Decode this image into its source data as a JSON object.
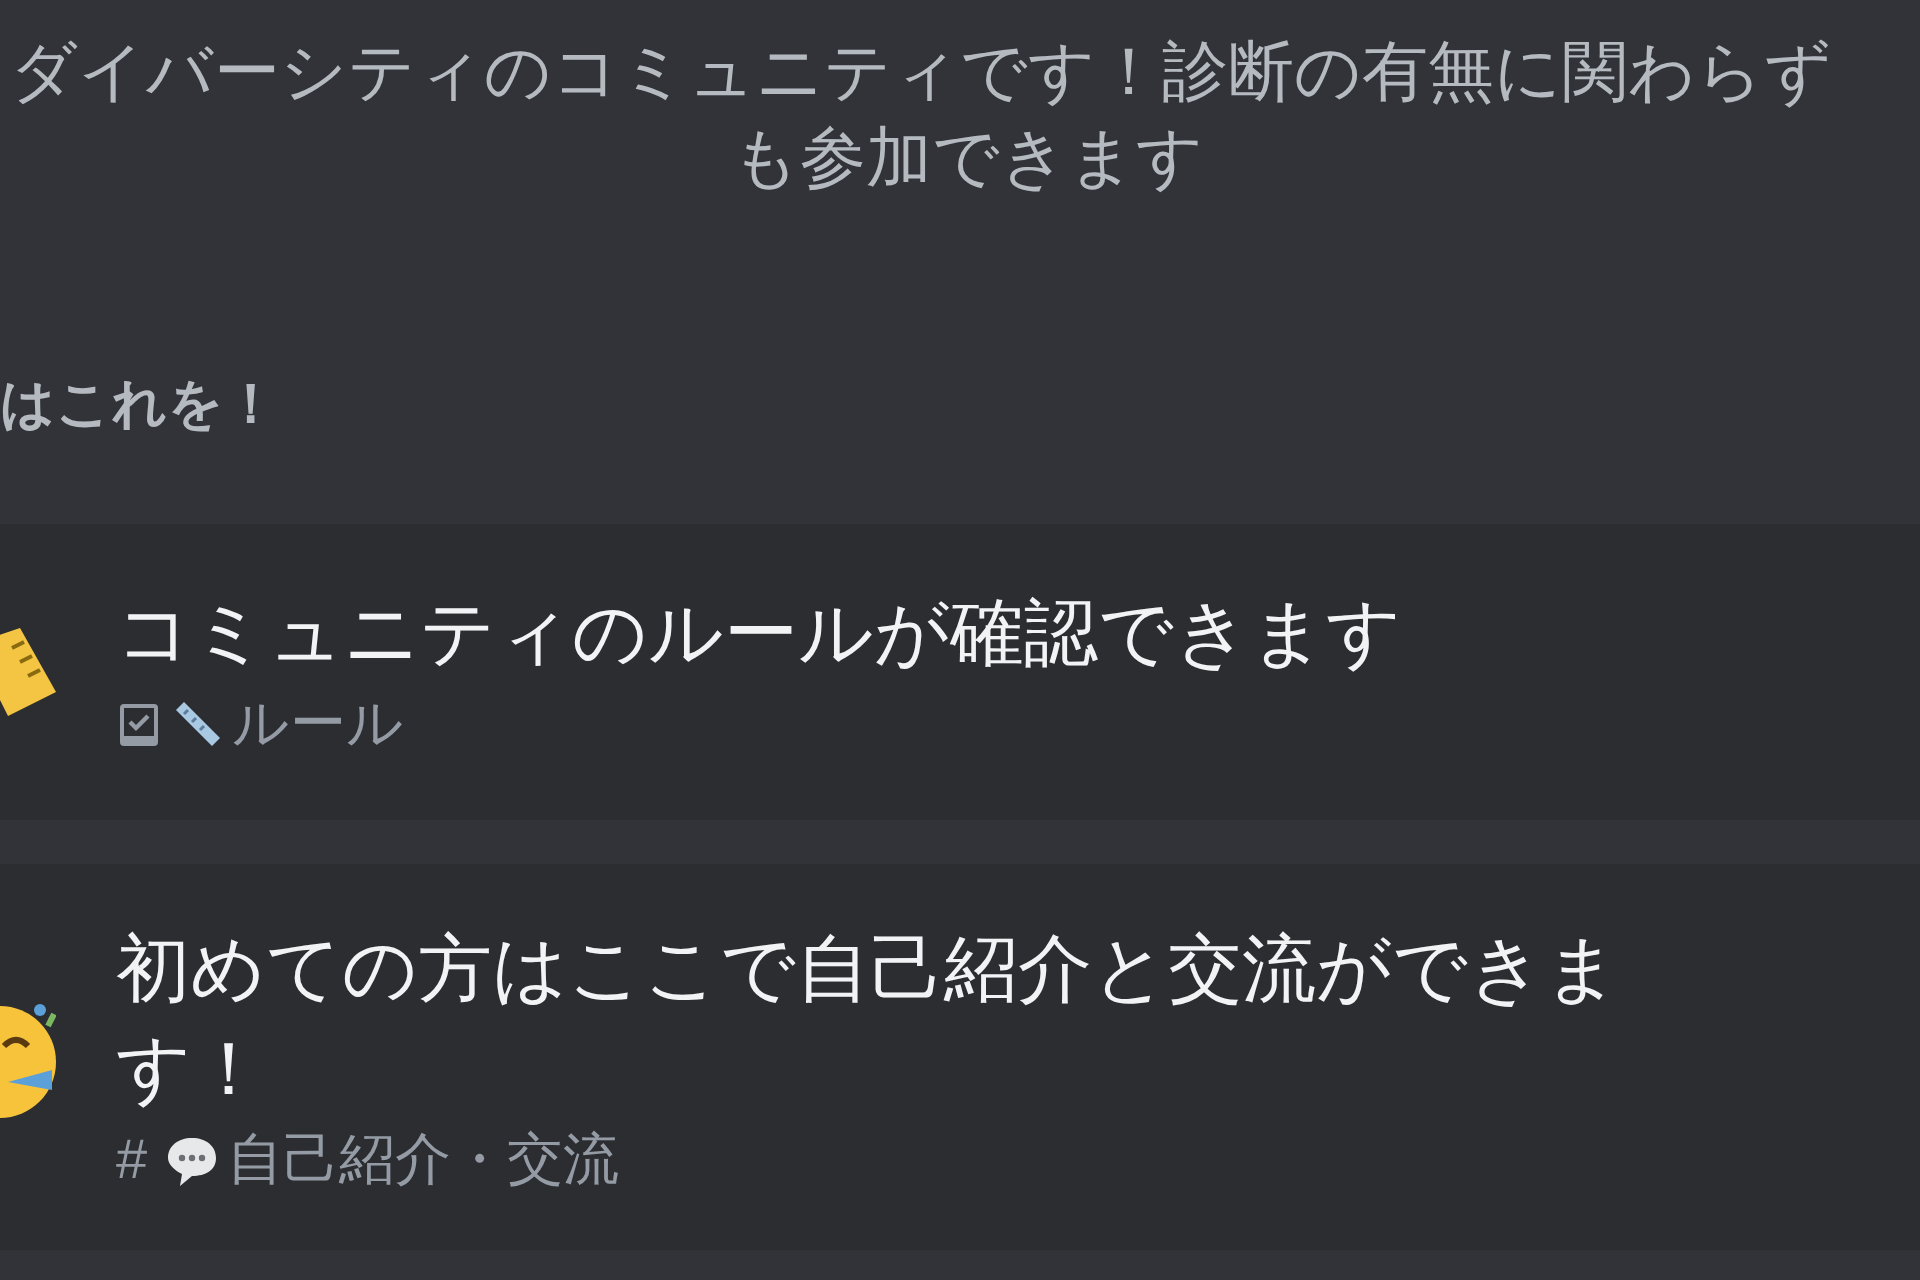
{
  "description": {
    "lines": [
      "ダイバーシティのコミュニティです！診断の有無に関わらず",
      "も参加できます"
    ]
  },
  "section_heading": "はこれを！",
  "cards": [
    {
      "kind": "rules",
      "title": "コミュニティのルールが確認できます",
      "channel": {
        "kind": "rules",
        "name": "ルール"
      }
    },
    {
      "kind": "intro",
      "title": "初めての方はここで自己紹介と交流ができます！",
      "channel": {
        "kind": "text",
        "symbol": "#",
        "name": "自己紹介・交流"
      }
    }
  ]
}
